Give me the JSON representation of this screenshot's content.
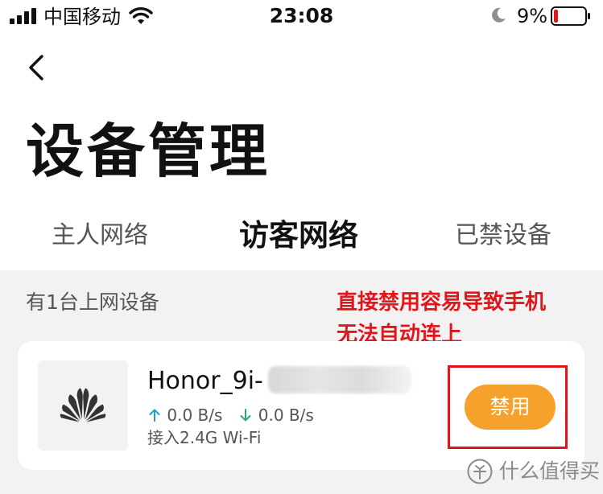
{
  "status_bar": {
    "carrier": "中国移动",
    "time": "23:08",
    "battery_percent": "9%",
    "icons": [
      "signal-icon",
      "wifi-icon",
      "moon-icon",
      "battery-icon"
    ]
  },
  "header": {
    "back_icon": "chevron-left-icon",
    "title": "设备管理"
  },
  "tabs": [
    {
      "label": "主人网络",
      "active": false
    },
    {
      "label": "访客网络",
      "active": true
    },
    {
      "label": "已禁设备",
      "active": false
    }
  ],
  "content": {
    "device_count": "有1台上网设备",
    "annotation": {
      "line1": "直接禁用容易导致手机",
      "line2": "无法自动连上"
    },
    "device": {
      "icon": "huawei-logo-icon",
      "name": "Honor_9i-",
      "upload_speed": "0.0 B/s",
      "download_speed": "0.0 B/s",
      "connection": "接入2.4G Wi-Fi",
      "action_label": "禁用"
    }
  },
  "watermark": {
    "text": "什么值得买"
  },
  "colors": {
    "accent_orange": "#f5a12c",
    "annotation_red": "#e0161b",
    "upload_arrow": "#1a9fd6",
    "download_arrow": "#2ea66e",
    "content_bg": "#f2f2f2"
  }
}
